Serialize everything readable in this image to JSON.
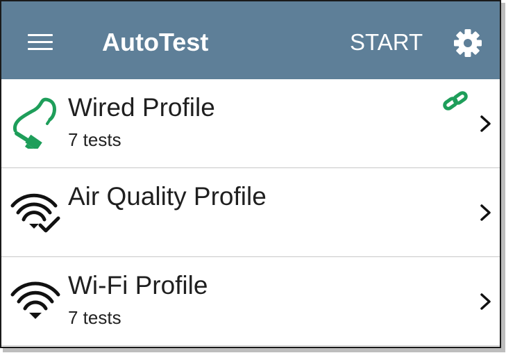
{
  "app": {
    "title": "AutoTest",
    "start_label": "START",
    "bar_color": "#5e7f98"
  },
  "icons": {
    "menu": "hamburger-menu-icon",
    "settings": "gear-icon"
  },
  "profiles": [
    {
      "title": "Wired Profile",
      "subtitle": "7 tests",
      "icon": "ethernet-cable-icon",
      "linked": true,
      "link_icon": "link-icon",
      "accent": "#1e9e5a"
    },
    {
      "title": "Air Quality Profile",
      "subtitle": "",
      "icon": "wifi-check-icon",
      "linked": false
    },
    {
      "title": "Wi-Fi Profile",
      "subtitle": "7 tests",
      "icon": "wifi-icon",
      "linked": false
    }
  ]
}
